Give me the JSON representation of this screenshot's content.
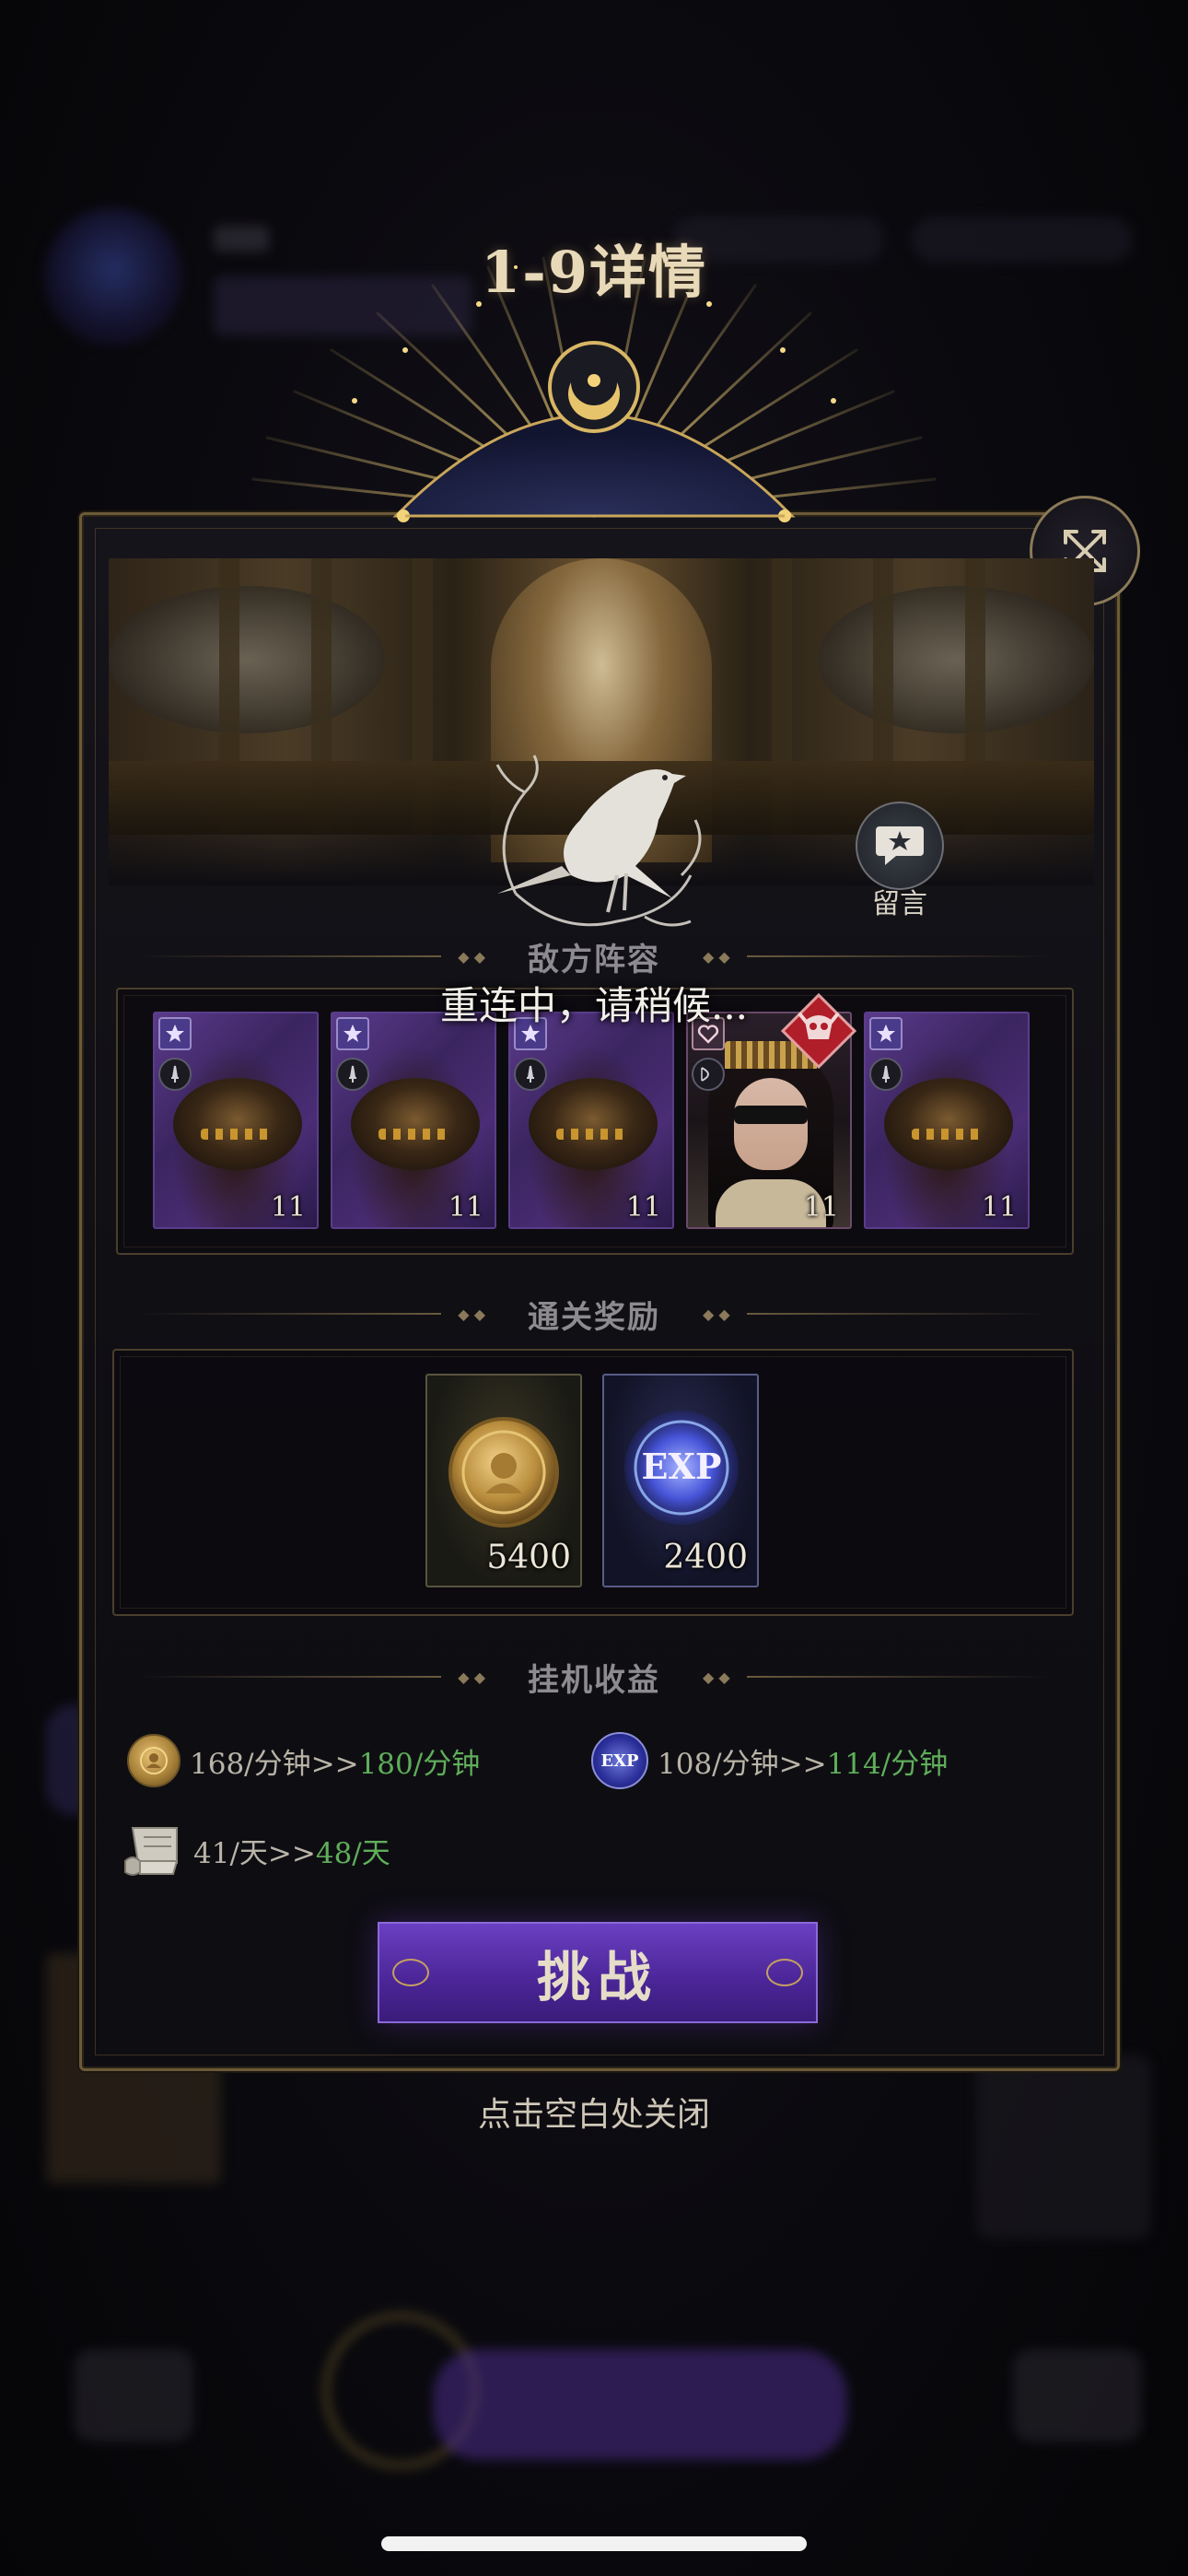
{
  "title": "1-9详情",
  "colors": {
    "panel_border": "#6c5a37",
    "gold_text": "#e8d9b8",
    "income_increase": "#5fae5a",
    "challenge_purple": "#4a2596"
  },
  "message_button": {
    "label": "留言",
    "icon": "chat-star-icon"
  },
  "sections": {
    "enemy_lineup": "敌方阵容",
    "clear_rewards": "通关奖励",
    "idle_income": "挂机收益"
  },
  "enemies": [
    {
      "type": "spider",
      "level": "11"
    },
    {
      "type": "spider",
      "level": "11"
    },
    {
      "type": "spider",
      "level": "11"
    },
    {
      "type": "masked-queen",
      "level": "11",
      "boss": true
    },
    {
      "type": "spider",
      "level": "11"
    }
  ],
  "rewards": [
    {
      "icon": "gold-coin-icon",
      "amount": "5400"
    },
    {
      "icon": "exp-orb-icon",
      "icon_text": "EXP",
      "amount": "2400"
    }
  ],
  "income": {
    "gold": {
      "icon": "gold-coin-icon",
      "old": "168/分钟>>",
      "new": "180/分钟"
    },
    "exp": {
      "icon": "exp-orb-icon",
      "icon_text": "EXP",
      "old": "108/分钟>>",
      "new": "114/分钟"
    },
    "scroll": {
      "icon": "scroll-icon",
      "old": "41/天>>",
      "new": "48/天"
    }
  },
  "challenge_button": "挑战",
  "close_hint": "点击空白处关闭",
  "reconnect_message": "重连中，请稍候..."
}
